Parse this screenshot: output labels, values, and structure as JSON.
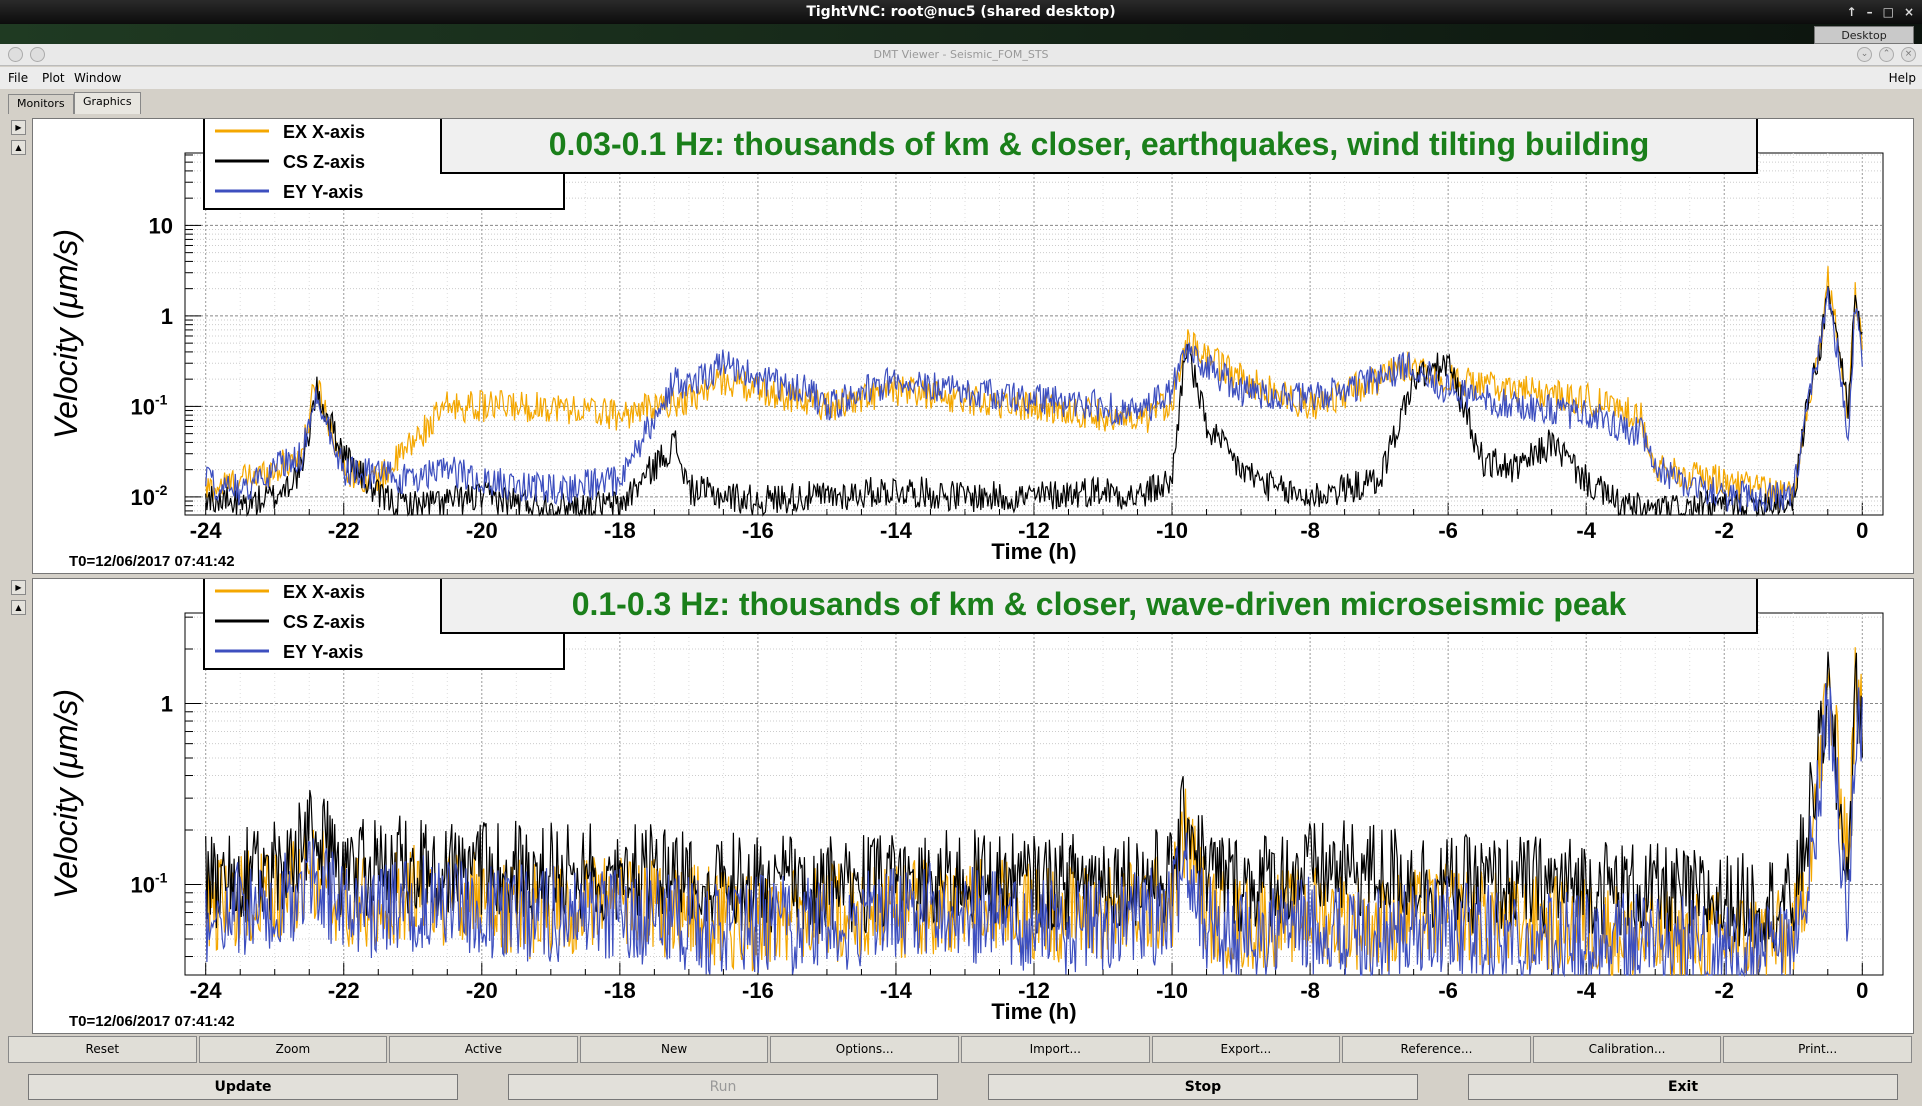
{
  "vnc": {
    "title": "TightVNC: root@nuc5 (shared desktop)",
    "controls": [
      "↑",
      "–",
      "□",
      "×"
    ],
    "desktop": "Desktop"
  },
  "window": {
    "title": "DMT Viewer - Seismic_FOM_STS"
  },
  "menu": {
    "file": "File",
    "plot": "Plot",
    "window": "Window",
    "help": "Help"
  },
  "tabs": [
    "Monitors",
    "Graphics"
  ],
  "colors": {
    "ex": "#f4a700",
    "cs": "#000000",
    "ey": "#3d4fbf",
    "title_text": "#1a7f1a"
  },
  "buttons_row1": [
    "Reset",
    "Zoom",
    "Active",
    "New",
    "Options...",
    "Import...",
    "Export...",
    "Reference...",
    "Calibration...",
    "Print..."
  ],
  "buttons_row2": {
    "update": "Update",
    "run": "Run",
    "stop": "Stop",
    "exit": "Exit"
  },
  "chart_data": [
    {
      "type": "line",
      "title": "0.03-0.1 Hz: thousands of km & closer, earthquakes, wind tilting building",
      "xlabel": "Time (h)",
      "ylabel": "Velocity  (μm/s)",
      "xlim": [
        -24.3,
        0.3
      ],
      "ylim_log10": [
        -2.2,
        1.8
      ],
      "yscale": "log",
      "x_ticks": [
        -24,
        -22,
        -20,
        -18,
        -16,
        -14,
        -12,
        -10,
        -8,
        -6,
        -4,
        -2,
        0
      ],
      "y_ticks": [
        {
          "exp": 1,
          "label": "10"
        },
        {
          "exp": 0,
          "label": "1"
        },
        {
          "exp": -1,
          "label": "10",
          "sup": "-1"
        },
        {
          "exp": -2,
          "label": "10",
          "sup": "-2"
        }
      ],
      "t0": "T0=12/06/2017 07:41:42",
      "legend": [
        "EX X-axis",
        "CS Z-axis",
        "EY Y-axis"
      ],
      "legend_position": "top-left",
      "grid": true,
      "series": [
        {
          "name": "EX X-axis",
          "color": "#f4a700",
          "x": [
            -24,
            -23.5,
            -23,
            -22.6,
            -22.4,
            -22,
            -21.5,
            -21,
            -20.5,
            -20,
            -19,
            -18,
            -17,
            -16.5,
            -16,
            -15.3,
            -15,
            -14,
            -13,
            -12,
            -11,
            -10.5,
            -10,
            -9.8,
            -9,
            -8,
            -7,
            -6.5,
            -6,
            -5,
            -4,
            -3.2,
            -3,
            -2,
            -1,
            -0.8,
            -0.6,
            -0.5,
            -0.3,
            -0.2,
            -0.1,
            0
          ],
          "y": [
            0.012,
            0.015,
            0.02,
            0.03,
            0.2,
            0.02,
            0.015,
            0.04,
            0.1,
            0.1,
            0.1,
            0.08,
            0.12,
            0.2,
            0.15,
            0.12,
            0.1,
            0.15,
            0.12,
            0.1,
            0.08,
            0.06,
            0.12,
            0.5,
            0.2,
            0.1,
            0.2,
            0.3,
            0.2,
            0.15,
            0.12,
            0.08,
            0.02,
            0.015,
            0.01,
            0.1,
            0.5,
            2.5,
            0.3,
            0.08,
            2,
            0.5
          ]
        },
        {
          "name": "CS Z-axis",
          "color": "#000000",
          "x": [
            -24,
            -23.5,
            -23,
            -22.6,
            -22.4,
            -22,
            -21.5,
            -21,
            -20,
            -19,
            -18,
            -17.2,
            -17,
            -16,
            -15.5,
            -15,
            -14,
            -13,
            -12,
            -11,
            -10.5,
            -10,
            -9.8,
            -9.5,
            -9,
            -8.5,
            -8,
            -7,
            -6.5,
            -6,
            -5.5,
            -5,
            -4.5,
            -4,
            -3.5,
            -3,
            -2,
            -1,
            -0.8,
            -0.6,
            -0.5,
            -0.3,
            -0.2,
            -0.1,
            0
          ],
          "y": [
            0.01,
            0.008,
            0.01,
            0.02,
            0.15,
            0.03,
            0.01,
            0.008,
            0.01,
            0.008,
            0.008,
            0.04,
            0.012,
            0.009,
            0.01,
            0.01,
            0.012,
            0.01,
            0.01,
            0.012,
            0.01,
            0.015,
            0.5,
            0.06,
            0.02,
            0.012,
            0.01,
            0.015,
            0.2,
            0.3,
            0.025,
            0.02,
            0.04,
            0.015,
            0.008,
            0.007,
            0.008,
            0.009,
            0.1,
            0.5,
            2,
            0.3,
            0.1,
            1.5,
            0.5
          ]
        },
        {
          "name": "EY Y-axis",
          "color": "#3d4fbf",
          "x": [
            -24,
            -23.5,
            -23,
            -22.6,
            -22.4,
            -22,
            -21,
            -20.5,
            -20,
            -19,
            -18,
            -17.2,
            -17,
            -16.5,
            -16,
            -15.3,
            -15,
            -14,
            -13,
            -12,
            -11,
            -10.5,
            -10,
            -9.8,
            -9,
            -8,
            -7,
            -6.5,
            -6,
            -5,
            -4,
            -3.2,
            -3,
            -2,
            -1,
            -0.8,
            -0.6,
            -0.5,
            -0.3,
            -0.2,
            -0.1,
            0
          ],
          "y": [
            0.015,
            0.012,
            0.02,
            0.03,
            0.15,
            0.02,
            0.015,
            0.02,
            0.015,
            0.012,
            0.015,
            0.2,
            0.15,
            0.3,
            0.2,
            0.15,
            0.1,
            0.2,
            0.15,
            0.12,
            0.1,
            0.08,
            0.15,
            0.4,
            0.15,
            0.12,
            0.2,
            0.3,
            0.15,
            0.1,
            0.08,
            0.05,
            0.02,
            0.01,
            0.01,
            0.1,
            0.5,
            2,
            0.2,
            0.05,
            1.5,
            0.3
          ]
        }
      ]
    },
    {
      "type": "line",
      "title": "0.1-0.3 Hz: thousands of km & closer, wave-driven microseismic peak",
      "xlabel": "Time (h)",
      "ylabel": "Velocity  (μm/s)",
      "xlim": [
        -24.3,
        0.3
      ],
      "ylim_log10": [
        -1.5,
        0.5
      ],
      "yscale": "log",
      "x_ticks": [
        -24,
        -22,
        -20,
        -18,
        -16,
        -14,
        -12,
        -10,
        -8,
        -6,
        -4,
        -2,
        0
      ],
      "y_ticks": [
        {
          "exp": 0,
          "label": "1"
        },
        {
          "exp": -1,
          "label": "10",
          "sup": "-1"
        }
      ],
      "t0": "T0=12/06/2017 07:41:42",
      "legend": [
        "EX X-axis",
        "CS Z-axis",
        "EY Y-axis"
      ],
      "legend_position": "top-left",
      "grid": true,
      "series": [
        {
          "name": "EX X-axis",
          "color": "#f4a700",
          "x": [
            -24,
            -23,
            -22.4,
            -22,
            -21,
            -20,
            -19,
            -18,
            -17,
            -16,
            -15,
            -14,
            -13,
            -12,
            -11,
            -10,
            -9.8,
            -9.5,
            -9,
            -8,
            -7,
            -6,
            -5,
            -4,
            -3,
            -2,
            -1,
            -0.8,
            -0.6,
            -0.5,
            -0.3,
            -0.2,
            -0.1,
            0
          ],
          "y": [
            0.08,
            0.09,
            0.12,
            0.08,
            0.09,
            0.08,
            0.07,
            0.08,
            0.07,
            0.06,
            0.07,
            0.07,
            0.08,
            0.07,
            0.07,
            0.08,
            0.2,
            0.07,
            0.06,
            0.07,
            0.06,
            0.07,
            0.06,
            0.06,
            0.05,
            0.05,
            0.05,
            0.12,
            0.5,
            1.3,
            0.3,
            0.15,
            1.2,
            0.8
          ]
        },
        {
          "name": "CS Z-axis",
          "color": "#000000",
          "x": [
            -24,
            -23,
            -22.4,
            -22,
            -21,
            -20,
            -19,
            -18,
            -17,
            -16,
            -15,
            -14,
            -13,
            -12,
            -11,
            -10,
            -9.8,
            -9.5,
            -9,
            -8,
            -7,
            -6,
            -5,
            -4,
            -3,
            -2,
            -1,
            -0.8,
            -0.6,
            -0.5,
            -0.3,
            -0.2,
            -0.1,
            0
          ],
          "y": [
            0.1,
            0.12,
            0.2,
            0.12,
            0.13,
            0.12,
            0.12,
            0.12,
            0.11,
            0.1,
            0.1,
            0.1,
            0.11,
            0.1,
            0.11,
            0.11,
            0.25,
            0.12,
            0.1,
            0.12,
            0.12,
            0.1,
            0.1,
            0.1,
            0.09,
            0.08,
            0.08,
            0.2,
            0.6,
            1.2,
            0.2,
            0.12,
            1.1,
            0.9
          ]
        },
        {
          "name": "EY Y-axis",
          "color": "#3d4fbf",
          "x": [
            -24,
            -23,
            -22.4,
            -22,
            -21,
            -20,
            -19,
            -18,
            -17,
            -16,
            -15,
            -14,
            -13,
            -12,
            -11,
            -10,
            -9.8,
            -9.5,
            -9,
            -8,
            -7,
            -6,
            -5,
            -4,
            -3,
            -2,
            -1,
            -0.8,
            -0.6,
            -0.5,
            -0.3,
            -0.2,
            -0.1,
            0
          ],
          "y": [
            0.07,
            0.08,
            0.1,
            0.07,
            0.08,
            0.07,
            0.07,
            0.07,
            0.06,
            0.06,
            0.06,
            0.07,
            0.07,
            0.06,
            0.06,
            0.07,
            0.15,
            0.06,
            0.05,
            0.06,
            0.05,
            0.06,
            0.05,
            0.05,
            0.05,
            0.04,
            0.04,
            0.1,
            0.4,
            1.1,
            0.15,
            0.06,
            0.9,
            0.6
          ]
        }
      ]
    }
  ]
}
